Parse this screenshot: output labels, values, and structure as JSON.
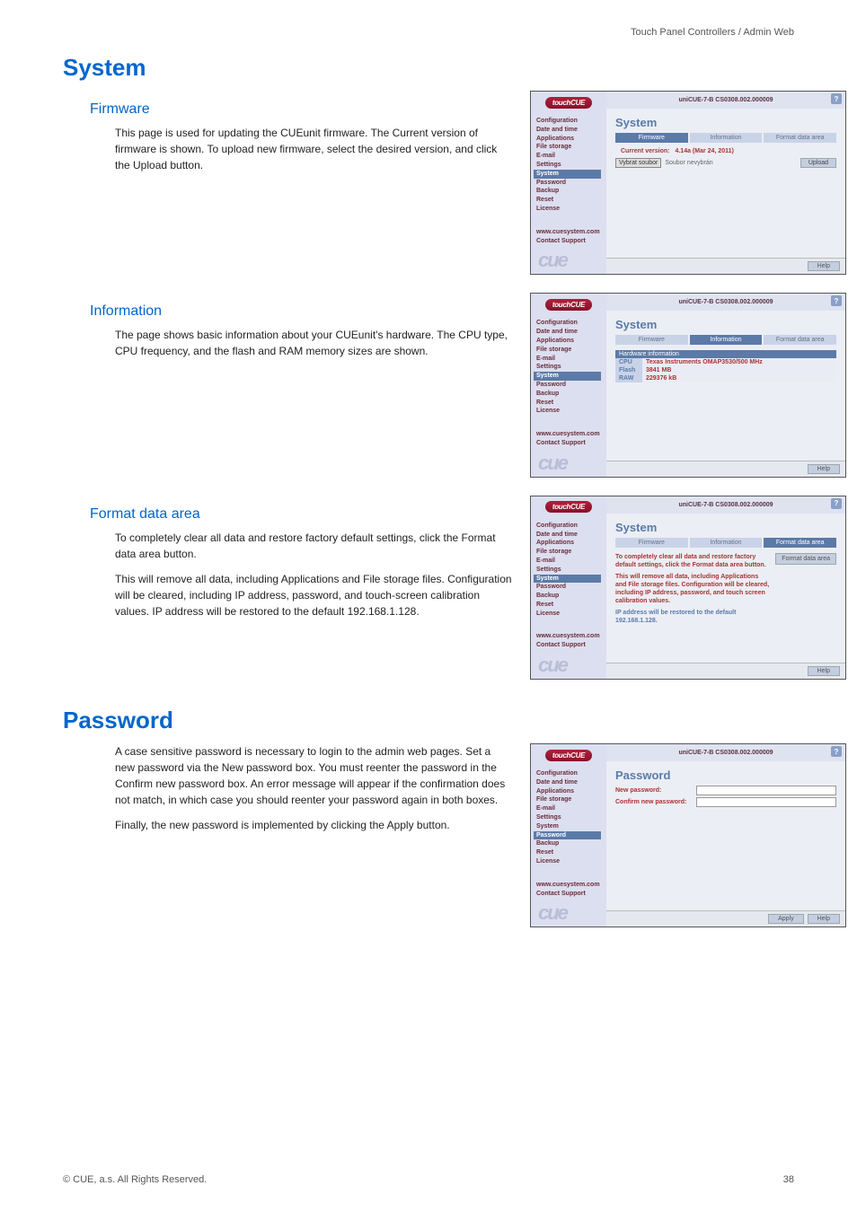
{
  "header_right": "Touch Panel Controllers / Admin Web",
  "sections": {
    "system": {
      "title": "System",
      "firmware": {
        "title": "Firmware",
        "para": "This page is used for updating the CUEunit firmware. The Current version of firmware is shown. To upload new firmware, select the desired version, and click the Upload button."
      },
      "information": {
        "title": "Information",
        "para": "The page shows basic information about your CUEunit's hardware. The CPU type, CPU frequency, and the flash and RAM memory sizes are shown."
      },
      "format": {
        "title": "Format data area",
        "para1": "To completely clear all data and restore factory default settings, click the Format data area button.",
        "para2": "This will remove all data, including Applications and File storage files. Configuration will be cleared, including IP address, password, and touch-screen calibration values. IP address will be restored to the default 192.168.1.128."
      }
    },
    "password": {
      "title": "Password",
      "para1": "A case sensitive password is necessary to login to the admin web pages. Set a new password via the New password box. You must reenter the password in the Confirm new password box. An error message will appear if the confirmation does not match, in which case you should reenter your password again in both boxes.",
      "para2": "Finally, the new password is implemented by clicking the Apply button."
    }
  },
  "shot": {
    "logo": "touchCUE",
    "device_title": "uniCUE-7-B   CS0308.002.000009",
    "nav": [
      "Configuration",
      "Date and time",
      "Applications",
      "File storage",
      "E-mail",
      "Settings",
      "System",
      "Password",
      "Backup",
      "Reset",
      "License"
    ],
    "links": [
      "www.cuesystem.com",
      "Contact Support"
    ],
    "cue": "cue",
    "help": "Help",
    "apply": "Apply",
    "qmark": "?",
    "system_heading": "System",
    "password_heading": "Password",
    "tabs": {
      "firmware": "Firmware",
      "information": "Information",
      "format": "Format data area"
    },
    "fw": {
      "current_label": "Current version:",
      "current_value": "4.14a (Mar 24, 2011)",
      "choose": "Vybrat soubor",
      "nofile": "Soubor nevybrán",
      "upload": "Upload"
    },
    "info": {
      "table_title": "Hardware information",
      "rows": [
        {
          "k": "CPU",
          "v": "Texas Instruments OMAP3530/500 MHz"
        },
        {
          "k": "Flash",
          "v": "3841 MB"
        },
        {
          "k": "RAW",
          "v": "229376 kB"
        }
      ]
    },
    "fmt": {
      "line1": "To completely clear all data and restore factory default settings, click the Format data area button.",
      "line2": "This will remove all data, including Applications and File storage files. Configuration will be cleared, including IP address, password, and touch screen calibration values.",
      "line3": "IP address will be restored to the default 192.168.1.128.",
      "btn": "Format data area"
    },
    "pw": {
      "new": "New password:",
      "confirm": "Confirm new password:"
    }
  },
  "footer": {
    "left": "© CUE, a.s. All Rights Reserved.",
    "right": "38"
  }
}
